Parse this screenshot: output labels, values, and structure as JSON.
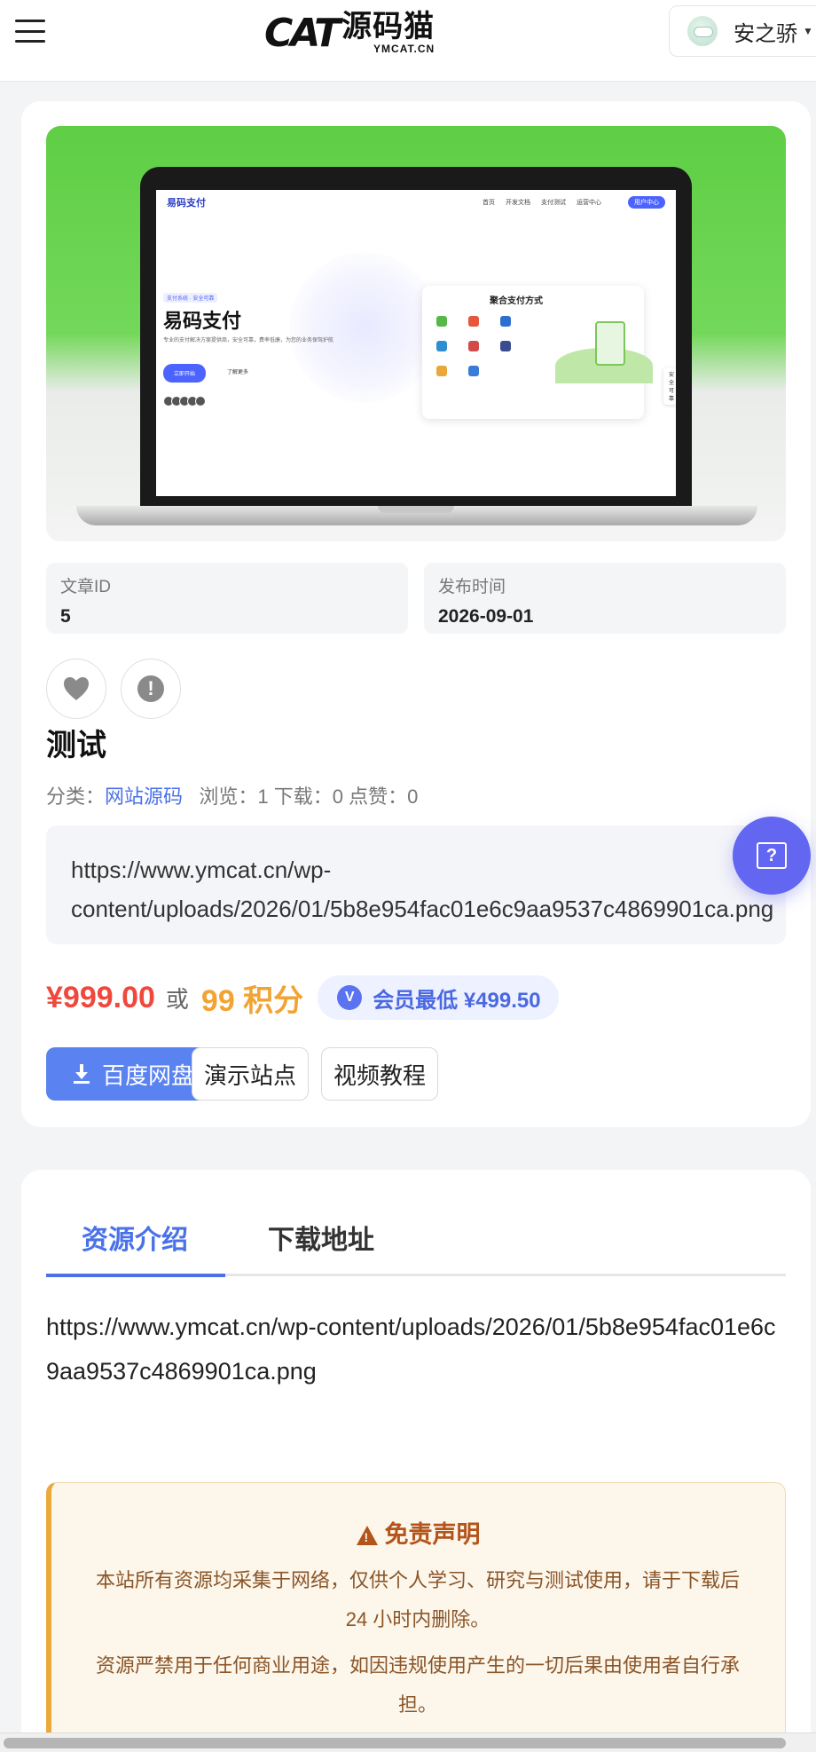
{
  "header": {
    "logo_text": "CAT",
    "logo_cn": "源码猫",
    "logo_en": "YMCAT.CN",
    "user_name": "安之骄"
  },
  "hero": {
    "screen": {
      "logo": "易码支付",
      "nav": [
        "首页",
        "开发文档",
        "支付测试",
        "运营中心"
      ],
      "login": "用户中心",
      "tag": "支付系统 · 安全可靠",
      "title": "易码支付",
      "desc": "专业的支付解决方案提供商，安全可靠，费率低廉，为您的业务保驾护航",
      "cta": "立即开始",
      "cta2": "了解更多",
      "panel_title": "聚合支付方式",
      "badge": "安全可靠"
    }
  },
  "meta": {
    "id_label": "文章ID",
    "id_value": "5",
    "date_label": "发布时间",
    "date_value": "2026-09-01"
  },
  "post": {
    "title": "测试",
    "category_label": "分类：",
    "category": "网站源码",
    "stats": "浏览：1   下载：0   点赞：0",
    "url_line1": "https://www.ymcat.cn/wp-",
    "url_line2": "content/uploads/2026/01/5b8e954fac01e6c9aa9537c4869901ca.png"
  },
  "pricing": {
    "price": "¥999.00",
    "or": "或",
    "points": "99 积分",
    "vip_badge": "V",
    "vip": "会员最低 ¥499.50"
  },
  "buttons": {
    "download": "百度网盘",
    "demo": "演示站点",
    "video": "视频教程"
  },
  "help": {
    "icon": "?"
  },
  "tabs": {
    "intro": "资源介绍",
    "download": "下载地址"
  },
  "content": {
    "intro_text": "https://www.ymcat.cn/wp-content/uploads/2026/01/5b8e954fac01e6c9aa9537c4869901ca.png"
  },
  "disclaimer": {
    "title": "免责声明",
    "p1": "本站所有资源均采集于网络，仅供个人学习、研究与测试使用，请于下载后 24 小时内删除。",
    "p2": "资源严禁用于任何商业用途，如因违规使用产生的一切后果由使用者自行承担。"
  },
  "colors": {
    "accent": "#4a72e8",
    "price": "#f0483c",
    "points": "#f2a332",
    "help": "#6366f1",
    "disclaimer_bg": "#fdf6ea",
    "disclaimer_text": "#b3541b"
  },
  "icons": [
    "menu-icon",
    "heart-icon",
    "report-icon",
    "download-icon",
    "help-icon",
    "warning-icon",
    "caret-down-icon"
  ]
}
